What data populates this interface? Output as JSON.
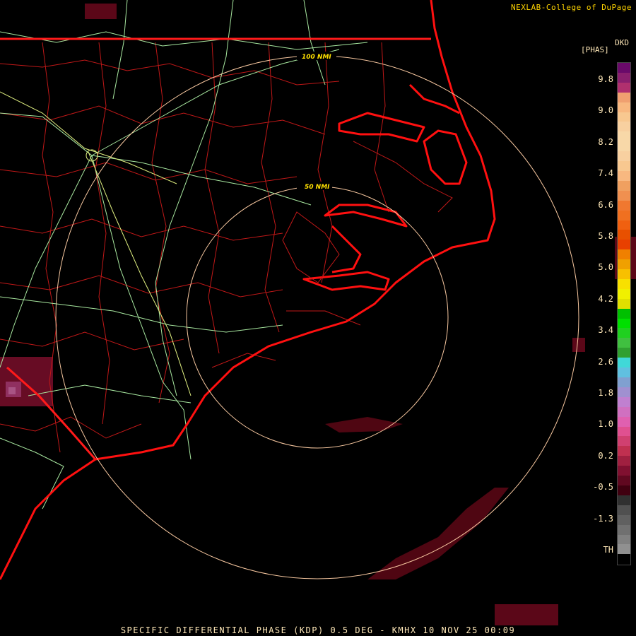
{
  "credit": "NEXLAB-College of DuPage",
  "product": {
    "code": "DKD",
    "unit": "[PHAS]"
  },
  "footer": "SPECIFIC DIFFERENTIAL PHASE (KDP) 0.5 DEG - KMHX 10 NOV 25 00:09",
  "range_rings": [
    "50 NMI",
    "100 NMI"
  ],
  "colorbar": {
    "ticks": [
      "9.8",
      "9.0",
      "8.2",
      "7.4",
      "6.6",
      "5.8",
      "5.0",
      "4.2",
      "3.4",
      "2.6",
      "1.8",
      "1.0",
      "0.2",
      "-0.5",
      "-1.3",
      "TH"
    ],
    "colors": [
      "#6a0a6a",
      "#8a1f6e",
      "#b0306e",
      "#f0a070",
      "#f8b880",
      "#f8c890",
      "#f8d0a0",
      "#f8d8a8",
      "#f8d8a8",
      "#f8d0a0",
      "#f8c890",
      "#f8b880",
      "#f0a060",
      "#f09050",
      "#f07830",
      "#f07020",
      "#f06010",
      "#e85000",
      "#e84000",
      "#f08000",
      "#f0a000",
      "#f8c000",
      "#f8e000",
      "#f0f000",
      "#e0e000",
      "#00c000",
      "#00e000",
      "#20d020",
      "#40c040",
      "#30a030",
      "#40d8d8",
      "#60c0e0",
      "#80a0d0",
      "#a090d0",
      "#c080d0",
      "#d070c0",
      "#e060b0",
      "#e05090",
      "#d04070",
      "#c03050",
      "#a02040",
      "#801030",
      "#600820",
      "#400010",
      "#303030",
      "#505050",
      "#606060",
      "#707070",
      "#808080",
      "#909090",
      "#000000"
    ]
  },
  "colors": {
    "state_border": "#ff1a1a",
    "county_border": "#c01818",
    "highway": "#a8e8a0",
    "range_ring": "#f8c8a0",
    "coast": "#ff1010"
  }
}
